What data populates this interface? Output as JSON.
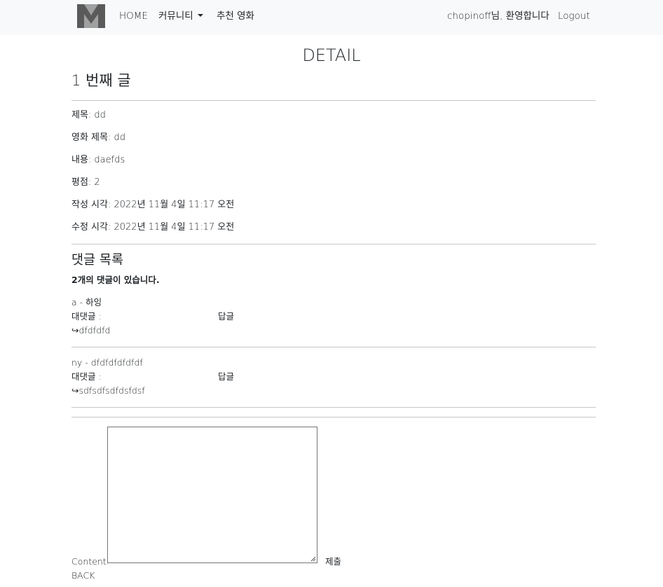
{
  "nav": {
    "home": "HOME",
    "community": "커뮤니티",
    "recommend": "추천 영화",
    "welcome": "chopinoff님, 환영합니다",
    "logout": "Logout"
  },
  "page_title": "DETAIL",
  "post": {
    "heading": "1 번째 글",
    "title": "제목: dd",
    "movie_title": "영화 제목: dd",
    "content": "내용: daefds",
    "rating": "평점: 2",
    "created_at": "작성 시각: 2022년 11월 4일 11:17 오전",
    "updated_at": "수정 시각: 2022년 11월 4일 11:17 오전"
  },
  "comments": {
    "heading": "댓글 목록",
    "count_text": "2개의 댓글이 있습니다.",
    "items": [
      {
        "author_line": "a - 하잉",
        "reply_label": "대댓글 :",
        "reply_button": "답글",
        "reply": "↪dfdfdfd"
      },
      {
        "author_line": "ny - dfdfdfdfdfdf",
        "reply_label": "대댓글 :",
        "reply_button": "답글",
        "reply": "↪sdfsdfsdfdsfdsf"
      }
    ]
  },
  "form": {
    "content_label": "Content:",
    "content_value": "",
    "submit": "제출"
  },
  "back": "BACK"
}
